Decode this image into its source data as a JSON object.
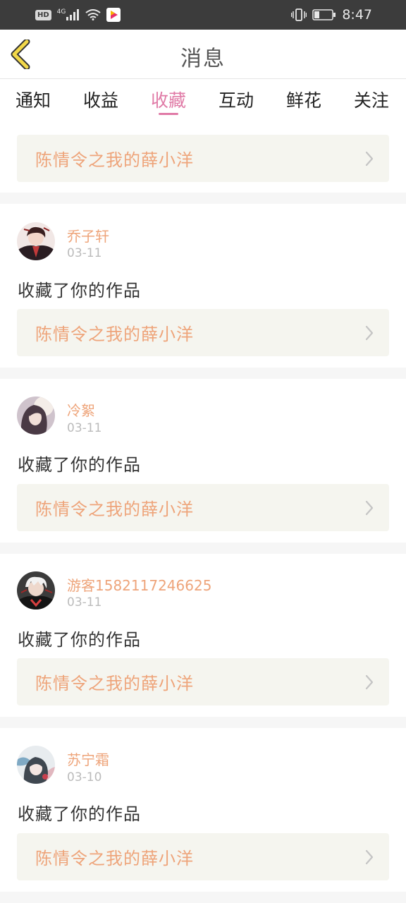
{
  "status_bar": {
    "hd": "HD",
    "network": "4G",
    "time": "8:47",
    "icons": [
      "signal-icon",
      "wifi-icon",
      "media-app-icon",
      "vibrate-icon",
      "battery-icon"
    ]
  },
  "header": {
    "title": "消息",
    "back_icon": "chevron-left-icon"
  },
  "tabs": [
    {
      "label": "通知"
    },
    {
      "label": "收益"
    },
    {
      "label": "收藏"
    },
    {
      "label": "互动"
    },
    {
      "label": "鲜花"
    },
    {
      "label": "关注"
    }
  ],
  "active_tab": "收藏",
  "top_work": {
    "title": "陈情令之我的薛小洋"
  },
  "items": [
    {
      "user": "乔子轩",
      "date": "03-11",
      "action": "收藏了你的作品",
      "work": "陈情令之我的薛小洋"
    },
    {
      "user": "冷絮",
      "date": "03-11",
      "action": "收藏了你的作品",
      "work": "陈情令之我的薛小洋"
    },
    {
      "user": "游客1582117246625",
      "date": "03-11",
      "action": "收藏了你的作品",
      "work": "陈情令之我的薛小洋"
    },
    {
      "user": "苏宁霜",
      "date": "03-10",
      "action": "收藏了你的作品",
      "work": "陈情令之我的薛小洋"
    }
  ],
  "colors": {
    "accent_pink": "#e07aa6",
    "name_orange": "#eea47a",
    "card_bg": "#f5f5ef",
    "status_bar": "#3c3c3c",
    "back_arrow": "#f2d84a"
  }
}
